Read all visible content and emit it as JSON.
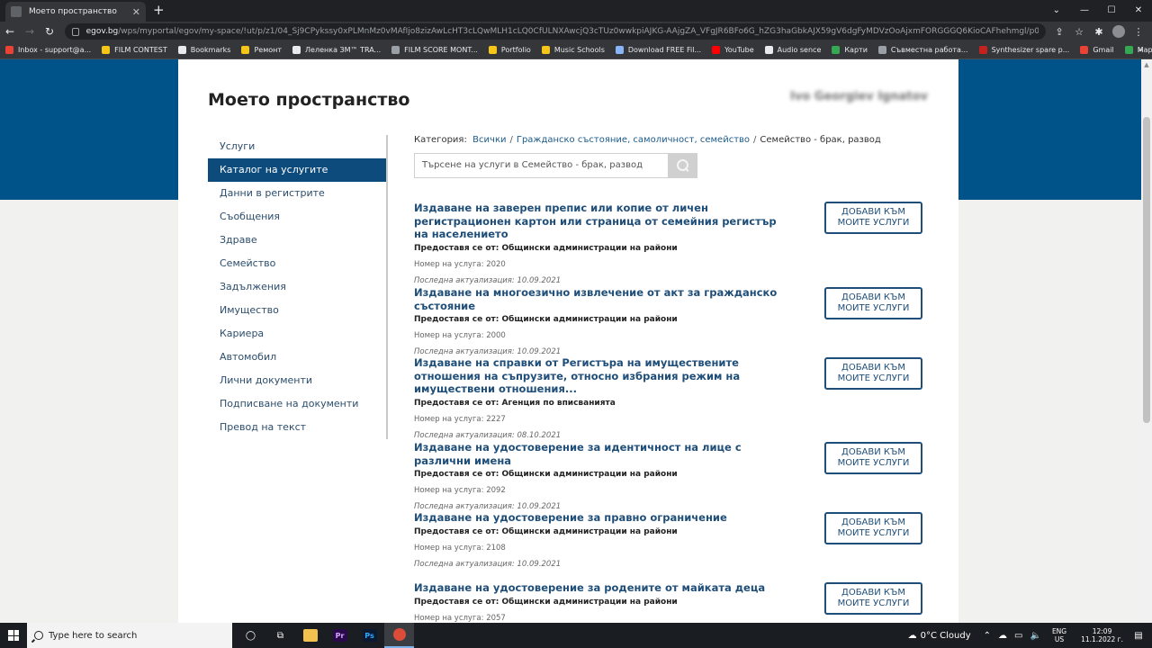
{
  "browser": {
    "tab_title": "Моето пространство",
    "tab_close": "✕",
    "new_tab": "+",
    "url_host": "egov.bg",
    "url_path": "/wps/myportal/egov/my-space/!ut/p/z1/04_Sj9CPykssy0xPLMnMz0vMAfIjo8zizAwLcHT3cLQwMLH1cLQ0CfULNXAwcjQ3cTUz0wwkpiAJKG-AAjgZA_VFgJR6BFo6G_hZG3haGbkAJX59gV6dgFyMDVzOoAjxmFORGGGQ6KioCAFhehmgl/p0/IZ7_PPGAHG800",
    "window": {
      "minimize": "—",
      "maximize": "☐",
      "close": "✕",
      "tab_search": "⌄"
    },
    "nav": {
      "back": "←",
      "forward": "→",
      "reload": "↻"
    },
    "toolbar_icons": {
      "share": "⇪",
      "star": "☆",
      "extensions": "✱",
      "menu": "⋮"
    }
  },
  "bookmarks": {
    "items": [
      {
        "label": "Inbox - support@a...",
        "color": "#ea4335"
      },
      {
        "label": "FILM CONTEST",
        "color": "#f5c518"
      },
      {
        "label": "Bookmarks",
        "color": "#e8eaed"
      },
      {
        "label": "Ремонт",
        "color": "#f5c518"
      },
      {
        "label": "Леленка ЗМ™ TRA...",
        "color": "#e8eaed"
      },
      {
        "label": "FILM SCORE MONT...",
        "color": "#9aa0a6"
      },
      {
        "label": "Portfolio",
        "color": "#f5c518"
      },
      {
        "label": "Music Schools",
        "color": "#f5c518"
      },
      {
        "label": "Download FREE Fil...",
        "color": "#8ab4f8"
      },
      {
        "label": "YouTube",
        "color": "#ff0000"
      },
      {
        "label": "Audio sence",
        "color": "#e8eaed"
      },
      {
        "label": "Карти",
        "color": "#34a853"
      },
      {
        "label": "Съвместна работа...",
        "color": "#9aa0a6"
      },
      {
        "label": "Synthesizer spare p...",
        "color": "#c5221f"
      },
      {
        "label": "Gmail",
        "color": "#ea4335"
      },
      {
        "label": "Maps",
        "color": "#34a853"
      }
    ],
    "more": "»"
  },
  "header": {
    "title": "Моето пространство",
    "user": "Ivo Georgiev Ignatov"
  },
  "sidebar": {
    "items": [
      {
        "label": "Услуги"
      },
      {
        "label": "Каталог на услугите"
      },
      {
        "label": "Данни в регистрите"
      },
      {
        "label": "Съобщения"
      },
      {
        "label": "Здраве"
      },
      {
        "label": "Семейство"
      },
      {
        "label": "Задължения"
      },
      {
        "label": "Имущество"
      },
      {
        "label": "Кариера"
      },
      {
        "label": "Автомобил"
      },
      {
        "label": "Лични документи"
      },
      {
        "label": "Подписване на документи"
      },
      {
        "label": "Превод на текст"
      }
    ],
    "active_index": 1
  },
  "breadcrumb": {
    "prefix": "Категория:",
    "all": "Всички",
    "separator": "/",
    "level1": "Гражданско състояние, самоличност, семейство",
    "level2": "Семейство - брак, развод"
  },
  "search": {
    "placeholder": "Търсене на услуги в Семейство - брак, развод"
  },
  "services": {
    "add_label": "ДОБАВИ КЪМ МОИТЕ УСЛУГИ",
    "items": [
      {
        "title": "Издаване на заверен препис или копие от личен регистрационен картон или страница от семейния регистър на населението",
        "provider": "Предоставя се от: Общински администрации на райони",
        "number": "Номер на услуга: 2020",
        "updated": "Последна актуализация: 10.09.2021"
      },
      {
        "title": "Издаване на многоезично извлечение от акт за гражданско състояние",
        "provider": "Предоставя се от: Общински администрации на райони",
        "number": "Номер на услуга: 2000",
        "updated": "Последна актуализация: 10.09.2021"
      },
      {
        "title": "Издаване на справки от Регистъра на имуществените отношения на съпрузите, относно избрания режим на имуществени отношения...",
        "provider": "Предоставя се от: Агенция по вписванията",
        "number": "Номер на услуга: 2227",
        "updated": "Последна актуализация: 08.10.2021"
      },
      {
        "title": "Издаване на удостоверение за идентичност на лице с различни имена",
        "provider": "Предоставя се от: Общински администрации на райони",
        "number": "Номер на услуга: 2092",
        "updated": "Последна актуализация: 10.09.2021"
      },
      {
        "title": "Издаване на удостоверение за правно ограничение",
        "provider": "Предоставя се от: Общински администрации на райони",
        "number": "Номер на услуга: 2108",
        "updated": "Последна актуализация: 10.09.2021"
      },
      {
        "title": "Издаване на удостоверение за родените от майката деца",
        "provider": "Предоставя се от: Общински администрации на райони",
        "number": "Номер на услуга: 2057",
        "updated": ""
      }
    ]
  },
  "taskbar": {
    "search_placeholder": "Type here to search",
    "weather": "0°C  Cloudy",
    "lang_top": "ENG",
    "lang_bottom": "US",
    "time": "12:09",
    "date": "11.1.2022 г.",
    "apps": [
      "cortana-icon",
      "task-view-icon",
      "file-explorer-icon",
      "premiere-icon",
      "photoshop-icon",
      "chrome-icon"
    ]
  },
  "colors": {
    "brand_blue": "#005389",
    "nav_active": "#0d4b7d",
    "link": "#1f4e79"
  }
}
